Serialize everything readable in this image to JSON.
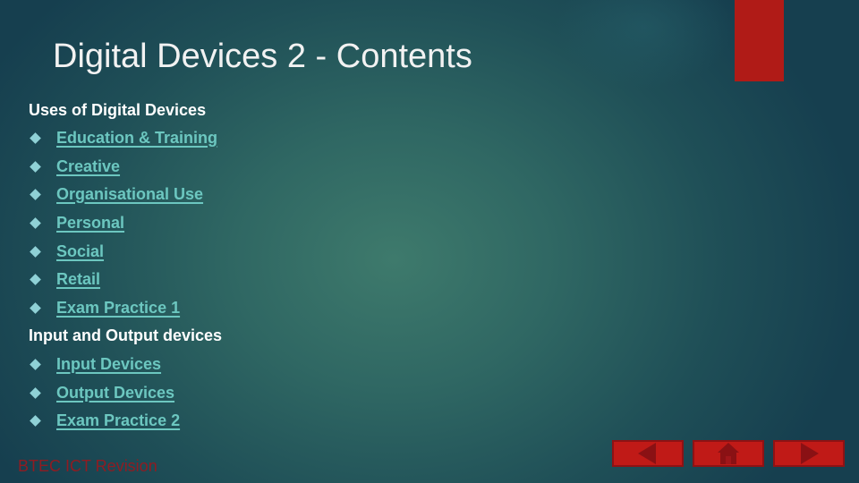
{
  "slide": {
    "title": "Digital Devices 2 - Contents",
    "footer": "BTEC ICT Revision"
  },
  "sections": [
    {
      "heading": "Uses of Digital Devices",
      "items": [
        {
          "label": "Education & Training"
        },
        {
          "label": "Creative"
        },
        {
          "label": "Organisational Use"
        },
        {
          "label": "Personal"
        },
        {
          "label": "Social"
        },
        {
          "label": "Retail"
        },
        {
          "label": "Exam Practice 1"
        }
      ]
    },
    {
      "heading": "Input and Output devices",
      "items": [
        {
          "label": "Input Devices"
        },
        {
          "label": "Output Devices"
        },
        {
          "label": "Exam Practice 2"
        }
      ]
    }
  ],
  "navigation": {
    "buttons": [
      {
        "icon": "arrow-left-icon",
        "label": "Previous"
      },
      {
        "icon": "home-icon",
        "label": "Home"
      },
      {
        "icon": "arrow-right-icon",
        "label": "Next"
      }
    ]
  },
  "colors": {
    "accent": "#b01b17",
    "link": "#6cc7c0",
    "bullet": "#8fd1d6",
    "footer": "#8f1c22"
  }
}
